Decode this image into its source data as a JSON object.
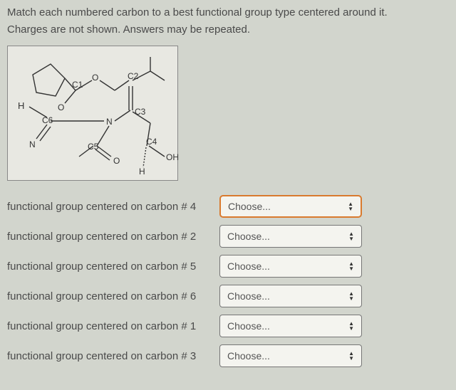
{
  "instructions": {
    "line1": "Match each numbered carbon to a best functional group type centered around it.",
    "line2": "Charges are not shown.  Answers may be repeated."
  },
  "labels": {
    "C1": "C1",
    "C2": "C2",
    "C3": "C3",
    "C4": "C4",
    "C5": "C5",
    "C6": "C6",
    "H": "H",
    "N1": "N",
    "N2": "N",
    "O1": "O",
    "O2": "O",
    "O3": "O",
    "OH": "OH",
    "Hdash": "H"
  },
  "rows": [
    {
      "label": "functional group centered on carbon # 4",
      "placeholder": "Choose...",
      "active": true
    },
    {
      "label": "functional group centered on carbon # 2",
      "placeholder": "Choose...",
      "active": false
    },
    {
      "label": "functional group centered on carbon # 5",
      "placeholder": "Choose...",
      "active": false
    },
    {
      "label": "functional group centered on carbon # 6",
      "placeholder": "Choose...",
      "active": false
    },
    {
      "label": "functional group centered on carbon # 1",
      "placeholder": "Choose...",
      "active": false
    },
    {
      "label": "functional group centered on carbon # 3",
      "placeholder": "Choose...",
      "active": false
    }
  ]
}
